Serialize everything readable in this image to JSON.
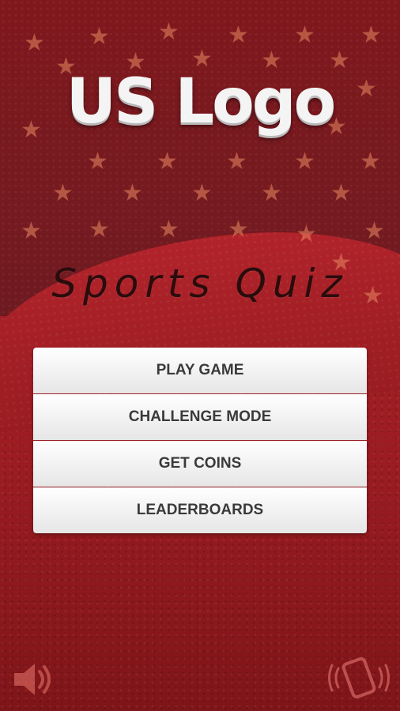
{
  "logo": {
    "text": "US Logo"
  },
  "subtitle": "Sports Quiz",
  "menu": {
    "play": "PLAY GAME",
    "challenge": "CHALLENGE MODE",
    "coins": "GET COINS",
    "leaderboards": "LEADERBOARDS"
  },
  "icons": {
    "sound": "speaker-icon",
    "vibrate": "phone-vibrate-icon"
  },
  "colors": {
    "background": "#8e1a1f",
    "stars": "#e88860",
    "button_text": "#3a3a3a"
  }
}
